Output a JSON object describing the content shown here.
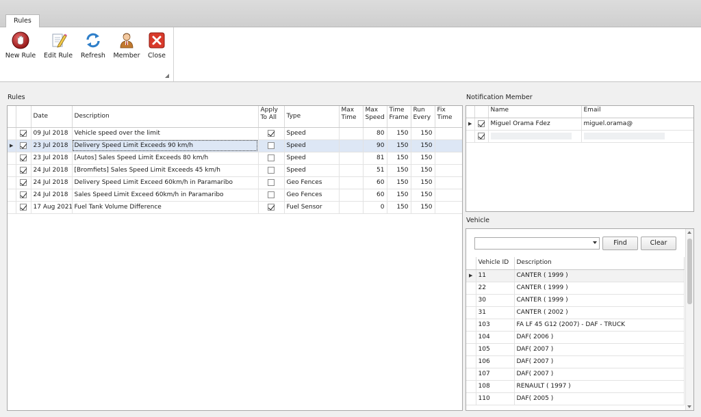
{
  "tab": {
    "label": "Rules"
  },
  "toolbar": [
    {
      "label": "New Rule",
      "icon": "hand-stop-icon"
    },
    {
      "label": "Edit Rule",
      "icon": "edit-pencil-icon"
    },
    {
      "label": "Refresh",
      "icon": "refresh-icon"
    },
    {
      "label": "Member",
      "icon": "member-icon"
    },
    {
      "label": "Close",
      "icon": "close-icon"
    }
  ],
  "rules": {
    "title": "Rules",
    "columns": {
      "date": "Date",
      "description": "Description",
      "apply_to_all": "Apply To All",
      "type": "Type",
      "max_time": "Max Time",
      "max_speed": "Max Speed",
      "time_frame": "Time Frame",
      "run_every": "Run Every",
      "fix_time": "Fix Time"
    },
    "rows": [
      {
        "checked": true,
        "date": "09 Jul 2018",
        "description": "Vehicle speed over the limit",
        "apply_to_all": true,
        "type": "Speed",
        "max_time": "",
        "max_speed": "80",
        "time_frame": "150",
        "run_every": "150",
        "fix_time": ""
      },
      {
        "checked": true,
        "date": "23 Jul 2018",
        "description": "Delivery Speed Limit Exceeds 90 km/h",
        "apply_to_all": false,
        "type": "Speed",
        "max_time": "",
        "max_speed": "90",
        "time_frame": "150",
        "run_every": "150",
        "fix_time": ""
      },
      {
        "checked": true,
        "date": "23 Jul 2018",
        "description": "[Autos] Sales Speed Limit Exceeds 80 km/h",
        "apply_to_all": false,
        "type": "Speed",
        "max_time": "",
        "max_speed": "81",
        "time_frame": "150",
        "run_every": "150",
        "fix_time": ""
      },
      {
        "checked": true,
        "date": "24 Jul 2018",
        "description": "[Bromfiets] Sales Speed Limit Exceeds 45 km/h",
        "apply_to_all": false,
        "type": "Speed",
        "max_time": "",
        "max_speed": "51",
        "time_frame": "150",
        "run_every": "150",
        "fix_time": ""
      },
      {
        "checked": true,
        "date": "24 Jul 2018",
        "description": "Delivery Speed Limit Exceed 60km/h in Paramaribo",
        "apply_to_all": false,
        "type": "Geo Fences",
        "max_time": "",
        "max_speed": "60",
        "time_frame": "150",
        "run_every": "150",
        "fix_time": ""
      },
      {
        "checked": true,
        "date": "24 Jul 2018",
        "description": "Sales Speed Limit Exceed 60km/h in Paramaribo",
        "apply_to_all": false,
        "type": "Geo Fences",
        "max_time": "",
        "max_speed": "60",
        "time_frame": "150",
        "run_every": "150",
        "fix_time": ""
      },
      {
        "checked": true,
        "date": "17 Aug 2021",
        "description": "Fuel Tank Volume Difference",
        "apply_to_all": true,
        "type": "Fuel Sensor",
        "max_time": "",
        "max_speed": "0",
        "time_frame": "150",
        "run_every": "150",
        "fix_time": ""
      }
    ]
  },
  "notification": {
    "title": "Notification Member",
    "columns": {
      "name": "Name",
      "email": "Email"
    },
    "rows": [
      {
        "checked": true,
        "name": "Miguel Orama Fdez",
        "email": "miguel.orama@"
      },
      {
        "checked": true,
        "name": "",
        "email": ""
      }
    ]
  },
  "vehicle": {
    "title": "Vehicle",
    "find_label": "Find",
    "clear_label": "Clear",
    "columns": {
      "id": "Vehicle ID",
      "description": "Description"
    },
    "rows": [
      {
        "id": "11",
        "description": "CANTER ( 1999 )"
      },
      {
        "id": "22",
        "description": "CANTER ( 1999 )"
      },
      {
        "id": "30",
        "description": "CANTER ( 1999 )"
      },
      {
        "id": "31",
        "description": "CANTER ( 2002 )"
      },
      {
        "id": "103",
        "description": "FA LF 45 G12 (2007) - DAF - TRUCK"
      },
      {
        "id": "104",
        "description": "DAF( 2006 )"
      },
      {
        "id": "105",
        "description": "DAF( 2007 )"
      },
      {
        "id": "106",
        "description": "DAF( 2007 )"
      },
      {
        "id": "107",
        "description": "DAF( 2007 )"
      },
      {
        "id": "108",
        "description": "RENAULT ( 1997 )"
      },
      {
        "id": "110",
        "description": "DAF( 2005 )"
      }
    ]
  }
}
